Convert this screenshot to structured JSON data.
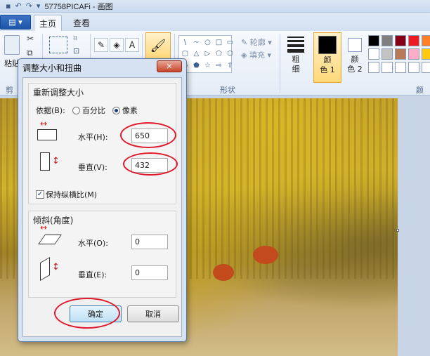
{
  "window": {
    "title": "57758PICAFi - 画图"
  },
  "quick_access": {
    "icons": [
      "save-icon",
      "undo-icon",
      "redo-icon",
      "customize-icon"
    ]
  },
  "tabs": {
    "file_label": "▤ ▾",
    "home_label": "主页",
    "view_label": "查看"
  },
  "ribbon": {
    "paste_label": "粘贴",
    "clipboard_group": "剪",
    "shapes_group": "形状",
    "colors_group": "颜色",
    "outline_label": "轮廓",
    "fill_label": "填充",
    "size_label_1": "粗",
    "size_label_2": "细",
    "color1_label_1": "颜",
    "color1_label_2": "色 1",
    "color2_label_1": "颜",
    "color2_label_2": "色 2",
    "tool_glyphs": [
      "✎",
      "◈",
      "A"
    ],
    "shape_glyphs": [
      "\\",
      "∼",
      "○",
      "□",
      "▭",
      "▢",
      "△",
      "▷",
      "⬠",
      "⬡",
      "◇",
      "⬟",
      "☆",
      "⇨",
      "⇧"
    ],
    "palette": [
      "#000000",
      "#7f7f7f",
      "#880015",
      "#ed1c24",
      "#ff7f27",
      "#ffffff",
      "#c3c3c3",
      "#b97a57",
      "#ffaec9",
      "#ffc90e",
      "#ffffff",
      "#ffffff",
      "#ffffff",
      "#ffffff",
      "#ffffff"
    ],
    "color1_value": "#000000",
    "color2_value": "#ffffff"
  },
  "dialog": {
    "title": "调整大小和扭曲",
    "close_glyph": "✕",
    "resize": {
      "section_title": "重新调整大小",
      "by_label": "依据(B):",
      "percent_label": "百分比",
      "pixels_label": "像素",
      "selected_unit": "像素",
      "horizontal_label": "水平(H):",
      "horizontal_value": "650",
      "vertical_label": "垂直(V):",
      "vertical_value": "432",
      "keep_ratio_label": "保持纵横比(M)",
      "keep_ratio_checked": true
    },
    "skew": {
      "section_title": "倾斜(角度)",
      "horizontal_label": "水平(O):",
      "horizontal_value": "0",
      "vertical_label": "垂直(E):",
      "vertical_value": "0"
    },
    "ok_label": "确定",
    "cancel_label": "取消",
    "annotation_color": "#e0192c"
  }
}
